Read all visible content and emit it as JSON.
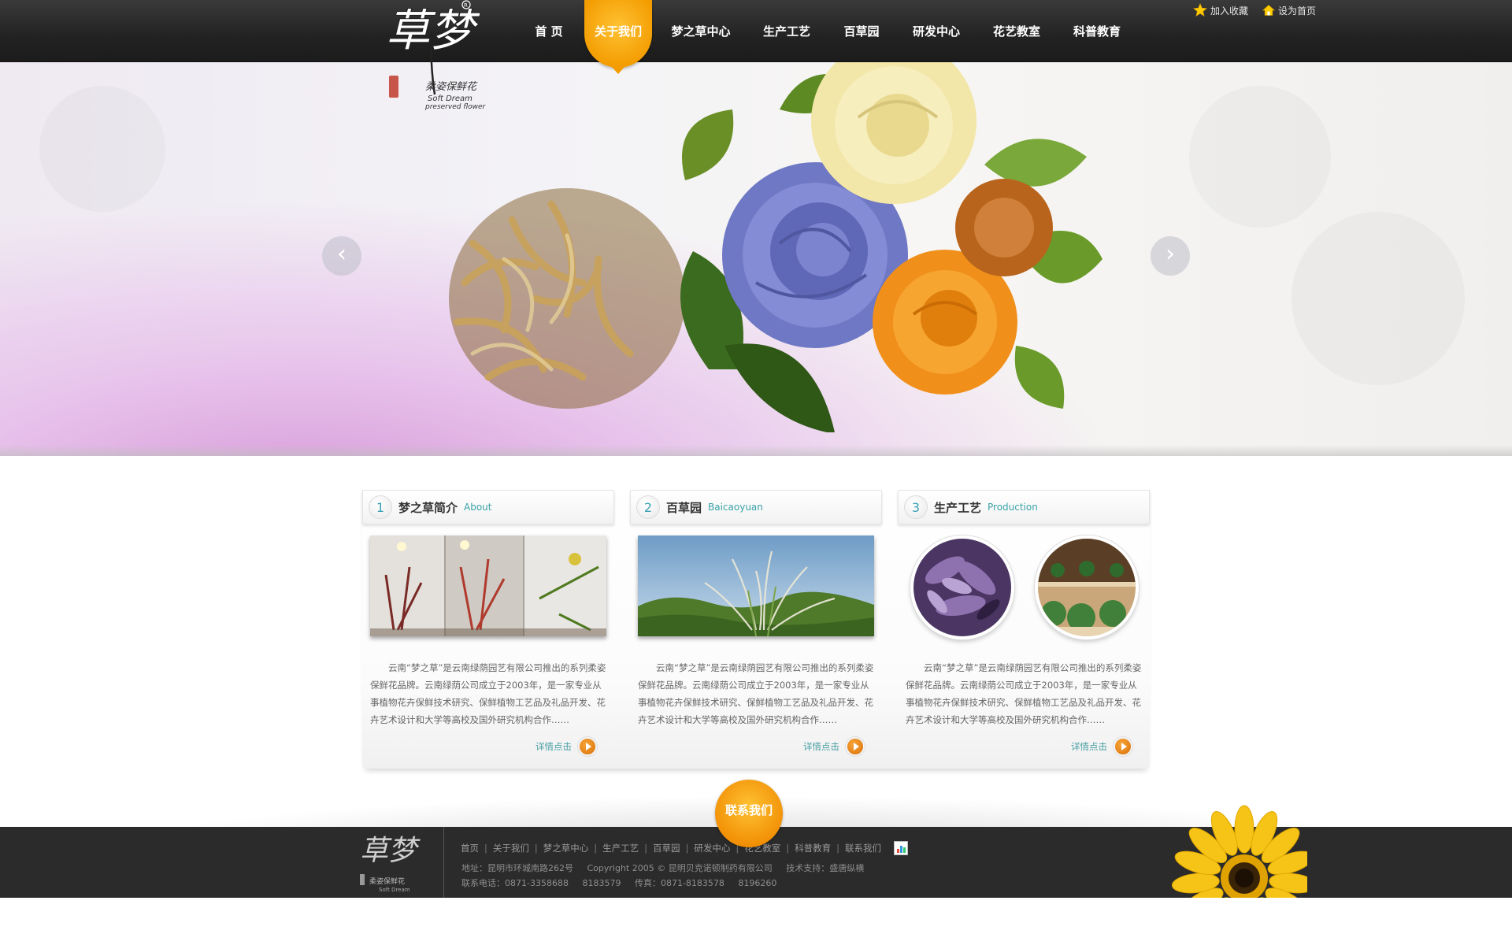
{
  "brand": {
    "logo_text": "草梦",
    "logo_chinese_sub": "柔姿保鲜花",
    "logo_english": "Soft Dream",
    "logo_english_sub": "preserved flower"
  },
  "nav": {
    "items": [
      {
        "label": "首 页",
        "active": false
      },
      {
        "label": "关于我们",
        "active": true
      },
      {
        "label": "梦之草中心",
        "active": false
      },
      {
        "label": "生产工艺",
        "active": false
      },
      {
        "label": "百草园",
        "active": false
      },
      {
        "label": "研发中心",
        "active": false
      },
      {
        "label": "花艺教室",
        "active": false
      },
      {
        "label": "科普教育",
        "active": false
      }
    ]
  },
  "toplinks": {
    "favorite": "加入收藏",
    "homepage": "设为首页"
  },
  "banner": {
    "prev_symbol": "‹",
    "next_symbol": "›"
  },
  "cards": [
    {
      "num": "1",
      "title": "梦之草简介",
      "subtitle": "About",
      "text": "云南“梦之草”是云南绿荫园艺有限公司推出的系列柔姿保鲜花品牌。云南绿荫公司成立于2003年，是一家专业从事植物花卉保鲜技术研究、保鲜植物工艺品及礼品开发、花卉艺术设计和大学等高校及国外研究机构合作……",
      "more": "详情点击"
    },
    {
      "num": "2",
      "title": "百草园",
      "subtitle": "Baicaoyuan",
      "text": "云南“梦之草”是云南绿荫园艺有限公司推出的系列柔姿保鲜花品牌。云南绿荫公司成立于2003年，是一家专业从事植物花卉保鲜技术研究、保鲜植物工艺品及礼品开发、花卉艺术设计和大学等高校及国外研究机构合作……",
      "more": "详情点击"
    },
    {
      "num": "3",
      "title": "生产工艺",
      "subtitle": "Production",
      "text": "云南“梦之草”是云南绿荫园艺有限公司推出的系列柔姿保鲜花品牌。云南绿荫公司成立于2003年，是一家专业从事植物花卉保鲜技术研究、保鲜植物工艺品及礼品开发、花卉艺术设计和大学等高校及国外研究机构合作……",
      "more": "详情点击"
    }
  ],
  "contact_button": "联系我们",
  "footer": {
    "links": [
      "首页",
      "关于我们",
      "梦之草中心",
      "生产工艺",
      "百草园",
      "研发中心",
      "花艺教室",
      "科普教育",
      "联系我们"
    ],
    "address": "地址：昆明市环城南路262号",
    "copyright": "Copyright 2005 © 昆明贝克诺顿制药有限公司",
    "support": "技术支持：盛唐纵横",
    "phone_label": "联系电话：0871-3358688",
    "phone2": "8183579",
    "fax": "传真：0871-8183578",
    "fax2": "8196260"
  },
  "colors": {
    "accent_orange": "#f39c00",
    "teal": "#3aa3a8",
    "header_dark": "#222222",
    "footer_dark": "#2b2b2b"
  }
}
